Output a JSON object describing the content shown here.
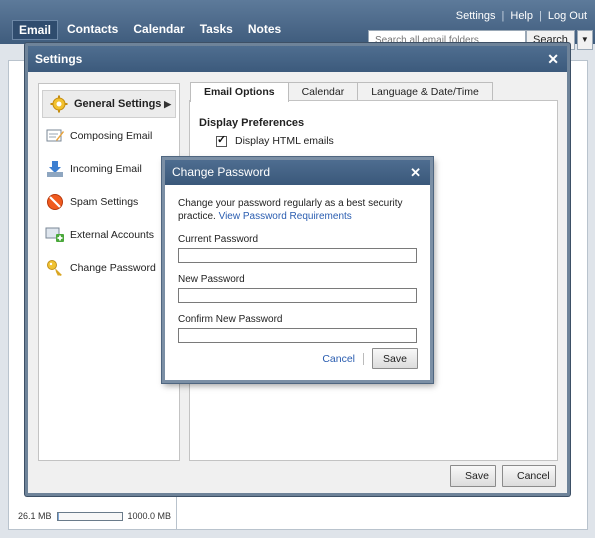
{
  "topnav": {
    "items": [
      "Email",
      "Contacts",
      "Calendar",
      "Tasks",
      "Notes"
    ],
    "active": "Email"
  },
  "utility": {
    "settings": "Settings",
    "help": "Help",
    "logout": "Log Out"
  },
  "search": {
    "placeholder": "Search all email folders",
    "button": "Search"
  },
  "storage": {
    "used": "26.1 MB",
    "total": "1000.0 MB",
    "fraction": 0.026
  },
  "settings_window": {
    "title": "Settings",
    "sidebar": [
      {
        "label": "General Settings",
        "icon": "gear-icon",
        "active": true
      },
      {
        "label": "Composing Email",
        "icon": "compose-icon"
      },
      {
        "label": "Incoming Email",
        "icon": "inbox-arrow-icon"
      },
      {
        "label": "Spam Settings",
        "icon": "no-entry-icon"
      },
      {
        "label": "External Accounts",
        "icon": "add-account-icon"
      },
      {
        "label": "Change Password",
        "icon": "key-icon"
      }
    ],
    "tabs": [
      "Email Options",
      "Calendar",
      "Language & Date/Time"
    ],
    "active_tab": "Email Options",
    "section_title": "Display Preferences",
    "options": [
      {
        "label": "Display HTML emails",
        "checked": true
      }
    ],
    "save": "Save",
    "cancel": "Cancel"
  },
  "dialog": {
    "title": "Change Password",
    "intro": "Change your password regularly as a best security practice.",
    "link": "View Password Requirements",
    "fields": {
      "current": "Current Password",
      "new": "New Password",
      "confirm": "Confirm New Password"
    },
    "cancel": "Cancel",
    "save": "Save"
  },
  "colors": {
    "titlebar": "#3f5c7d",
    "link": "#2a5db0"
  }
}
